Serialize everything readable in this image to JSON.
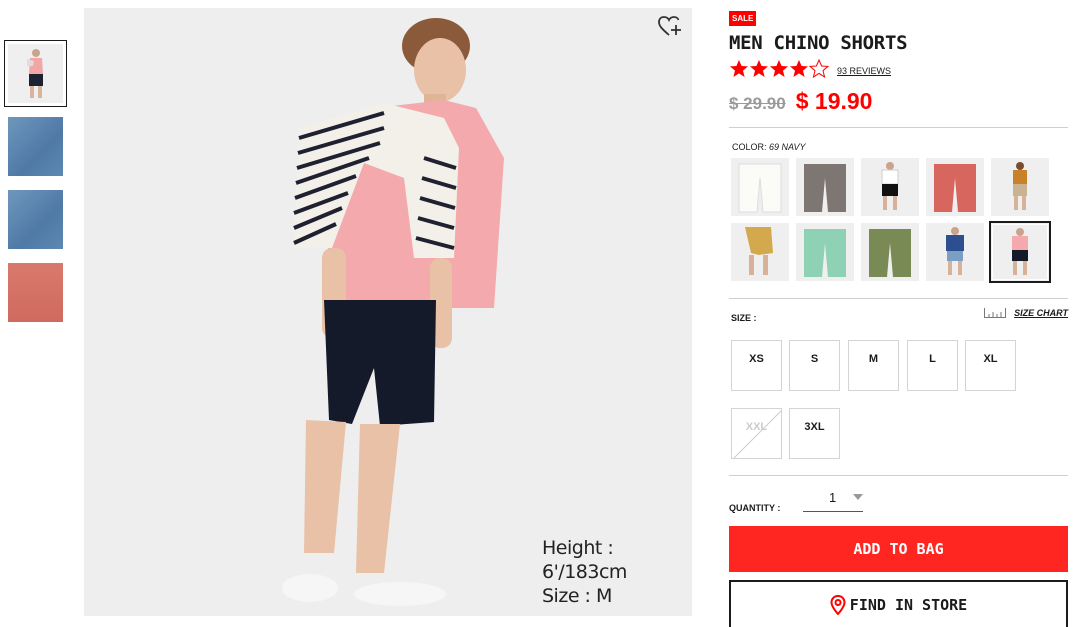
{
  "product": {
    "badge": "SALE",
    "title": "MEN CHINO SHORTS",
    "rating": 4.5,
    "stars": "★★★★★",
    "reviews_label": "93 REVIEWS",
    "old_price": "$ 29.90",
    "new_price": "$ 19.90"
  },
  "gallery": {
    "model_height": "Height : 6'/183cm",
    "model_size": "Size : M"
  },
  "color": {
    "label": "COLOR:",
    "selected": "69 NAVY",
    "swatches": [
      {
        "name": "off-white",
        "hex": "#f2f1ee"
      },
      {
        "name": "gray",
        "hex": "#7d7672"
      },
      {
        "name": "black-model",
        "hex": "#eeeeee"
      },
      {
        "name": "coral",
        "hex": "#d7675e"
      },
      {
        "name": "brown-model",
        "hex": "#eeeeee"
      },
      {
        "name": "beige-model",
        "hex": "#eeeeee"
      },
      {
        "name": "mint",
        "hex": "#8fd1b4"
      },
      {
        "name": "olive",
        "hex": "#7a8a55"
      },
      {
        "name": "blue-model",
        "hex": "#eeeeee"
      },
      {
        "name": "navy-model",
        "hex": "#eeeeee"
      }
    ]
  },
  "size": {
    "label": "SIZE :",
    "chart_label": "SIZE CHART",
    "options": [
      "XS",
      "S",
      "M",
      "L",
      "XL",
      "XXL",
      "3XL"
    ],
    "unavailable": [
      "XXL"
    ]
  },
  "quantity": {
    "label": "QUANTITY :",
    "value": "1"
  },
  "actions": {
    "add_to_bag": "ADD TO BAG",
    "find_in_store": "FIND IN STORE"
  },
  "colors": {
    "accent": "#ff0000",
    "button": "#ff2621"
  }
}
